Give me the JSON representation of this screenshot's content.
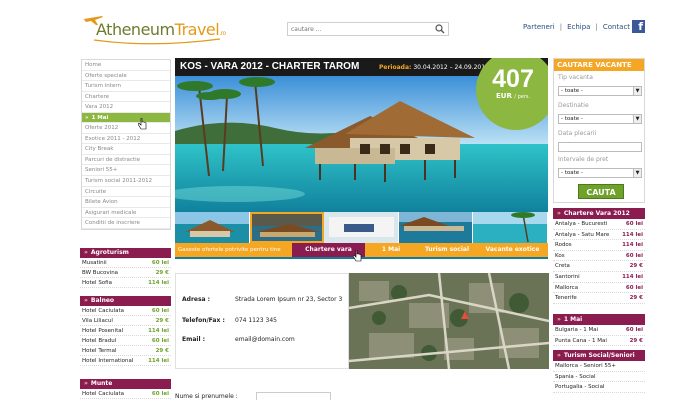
{
  "header": {
    "logo_part1": "Atheneum",
    "logo_part2": "Travel",
    "logo_suffix": ".ro",
    "search_placeholder": "cautare ...",
    "nav": [
      "Parteneri",
      "Echipa",
      "Contact"
    ],
    "separator": "|",
    "facebook": "f"
  },
  "leftnav": {
    "items": [
      "Home",
      "Oferte speciale",
      "Turism intern",
      "Chartere",
      "Vara 2012",
      "1 Mai",
      "Oferte 2012",
      "Exotice 2011 - 2012",
      "City Break",
      "Parcuri de distractie",
      "Seniori 55+",
      "Turism social 2011-2012",
      "Circuite",
      "Bilete Avion",
      "Asigurari medicale",
      "Conditii de inscriere"
    ],
    "active_index": 5,
    "chevron": "»"
  },
  "left_lists": [
    {
      "title": "Agroturism",
      "rows": [
        [
          "Musatinii",
          "60 lei"
        ],
        [
          "BW Bucovina",
          "29 €"
        ],
        [
          "Hotel Sofia",
          "114 lei"
        ]
      ]
    },
    {
      "title": "Balneo",
      "rows": [
        [
          "Hotel Caciulata",
          "60 lei"
        ],
        [
          "Vila Liliacul",
          "29 €"
        ],
        [
          "Hotel Posenital",
          "114 lei"
        ],
        [
          "Hotel Bradul",
          "60 lei"
        ],
        [
          "Hotel Termal",
          "29 €"
        ],
        [
          "Hotel International",
          "114 lei"
        ]
      ]
    },
    {
      "title": "Munte",
      "rows": [
        [
          "Hotel Caciulata",
          "60 lei"
        ]
      ]
    }
  ],
  "hero": {
    "title": "KOS - VARA 2012 - CHARTER TAROM",
    "period_label": "Perioada:",
    "period_value": "30.04.2012 – 24.09.2012",
    "price": "407",
    "currency": "EUR",
    "per": "/ pers."
  },
  "tabs": {
    "intro": "Gaseste ofertele potrivite pentru tine",
    "items": [
      "Chartere vara",
      "1 Mai",
      "Turism social",
      "Vacante exotice"
    ],
    "selected_index": 0
  },
  "contact": {
    "address_label": "Adresa :",
    "address_value": "Strada Lorem Ipsum nr 23, Sector 3",
    "phone_label": "Telefon/Fax :",
    "phone_value": "074 1123 345",
    "email_label": "Email :",
    "email_value": "email@domain.com",
    "form_label": "Nume si prenumele :"
  },
  "search_panel": {
    "title": "CAUTARE VACANTE",
    "fields": [
      {
        "label": "Tip vacanta",
        "value": "- toate -"
      },
      {
        "label": "Destinatie",
        "value": "- toate -"
      },
      {
        "label": "Data plecarii",
        "value": ""
      },
      {
        "label": "Intervale de pret",
        "value": "- toate -"
      }
    ],
    "button": "CAUTA",
    "arrow": "▼"
  },
  "right_lists": [
    {
      "title": "Chartere Vara 2012",
      "rows": [
        [
          "Antalya - Bucuresti",
          "60 lei"
        ],
        [
          "Antalya - Satu Mare",
          "114 lei"
        ],
        [
          "Rodos",
          "114 lei"
        ],
        [
          "Kos",
          "60 lei"
        ],
        [
          "Creta",
          "29 €"
        ],
        [
          "Santorini",
          "114 lei"
        ],
        [
          "Mallorca",
          "60 lei"
        ],
        [
          "Tenerife",
          "29 €"
        ]
      ]
    },
    {
      "title": "1 Mai",
      "rows": [
        [
          "Bulgaria - 1 Mai",
          "60 lei"
        ],
        [
          "Punta Cana - 1 Mai",
          "29 €"
        ]
      ]
    },
    {
      "title": "Turism Social/Seniori",
      "rows": [
        [
          "Mallorca - Seniori 55+",
          ""
        ],
        [
          "Spania - Social",
          ""
        ],
        [
          "Portugalia - Social",
          ""
        ]
      ]
    }
  ]
}
